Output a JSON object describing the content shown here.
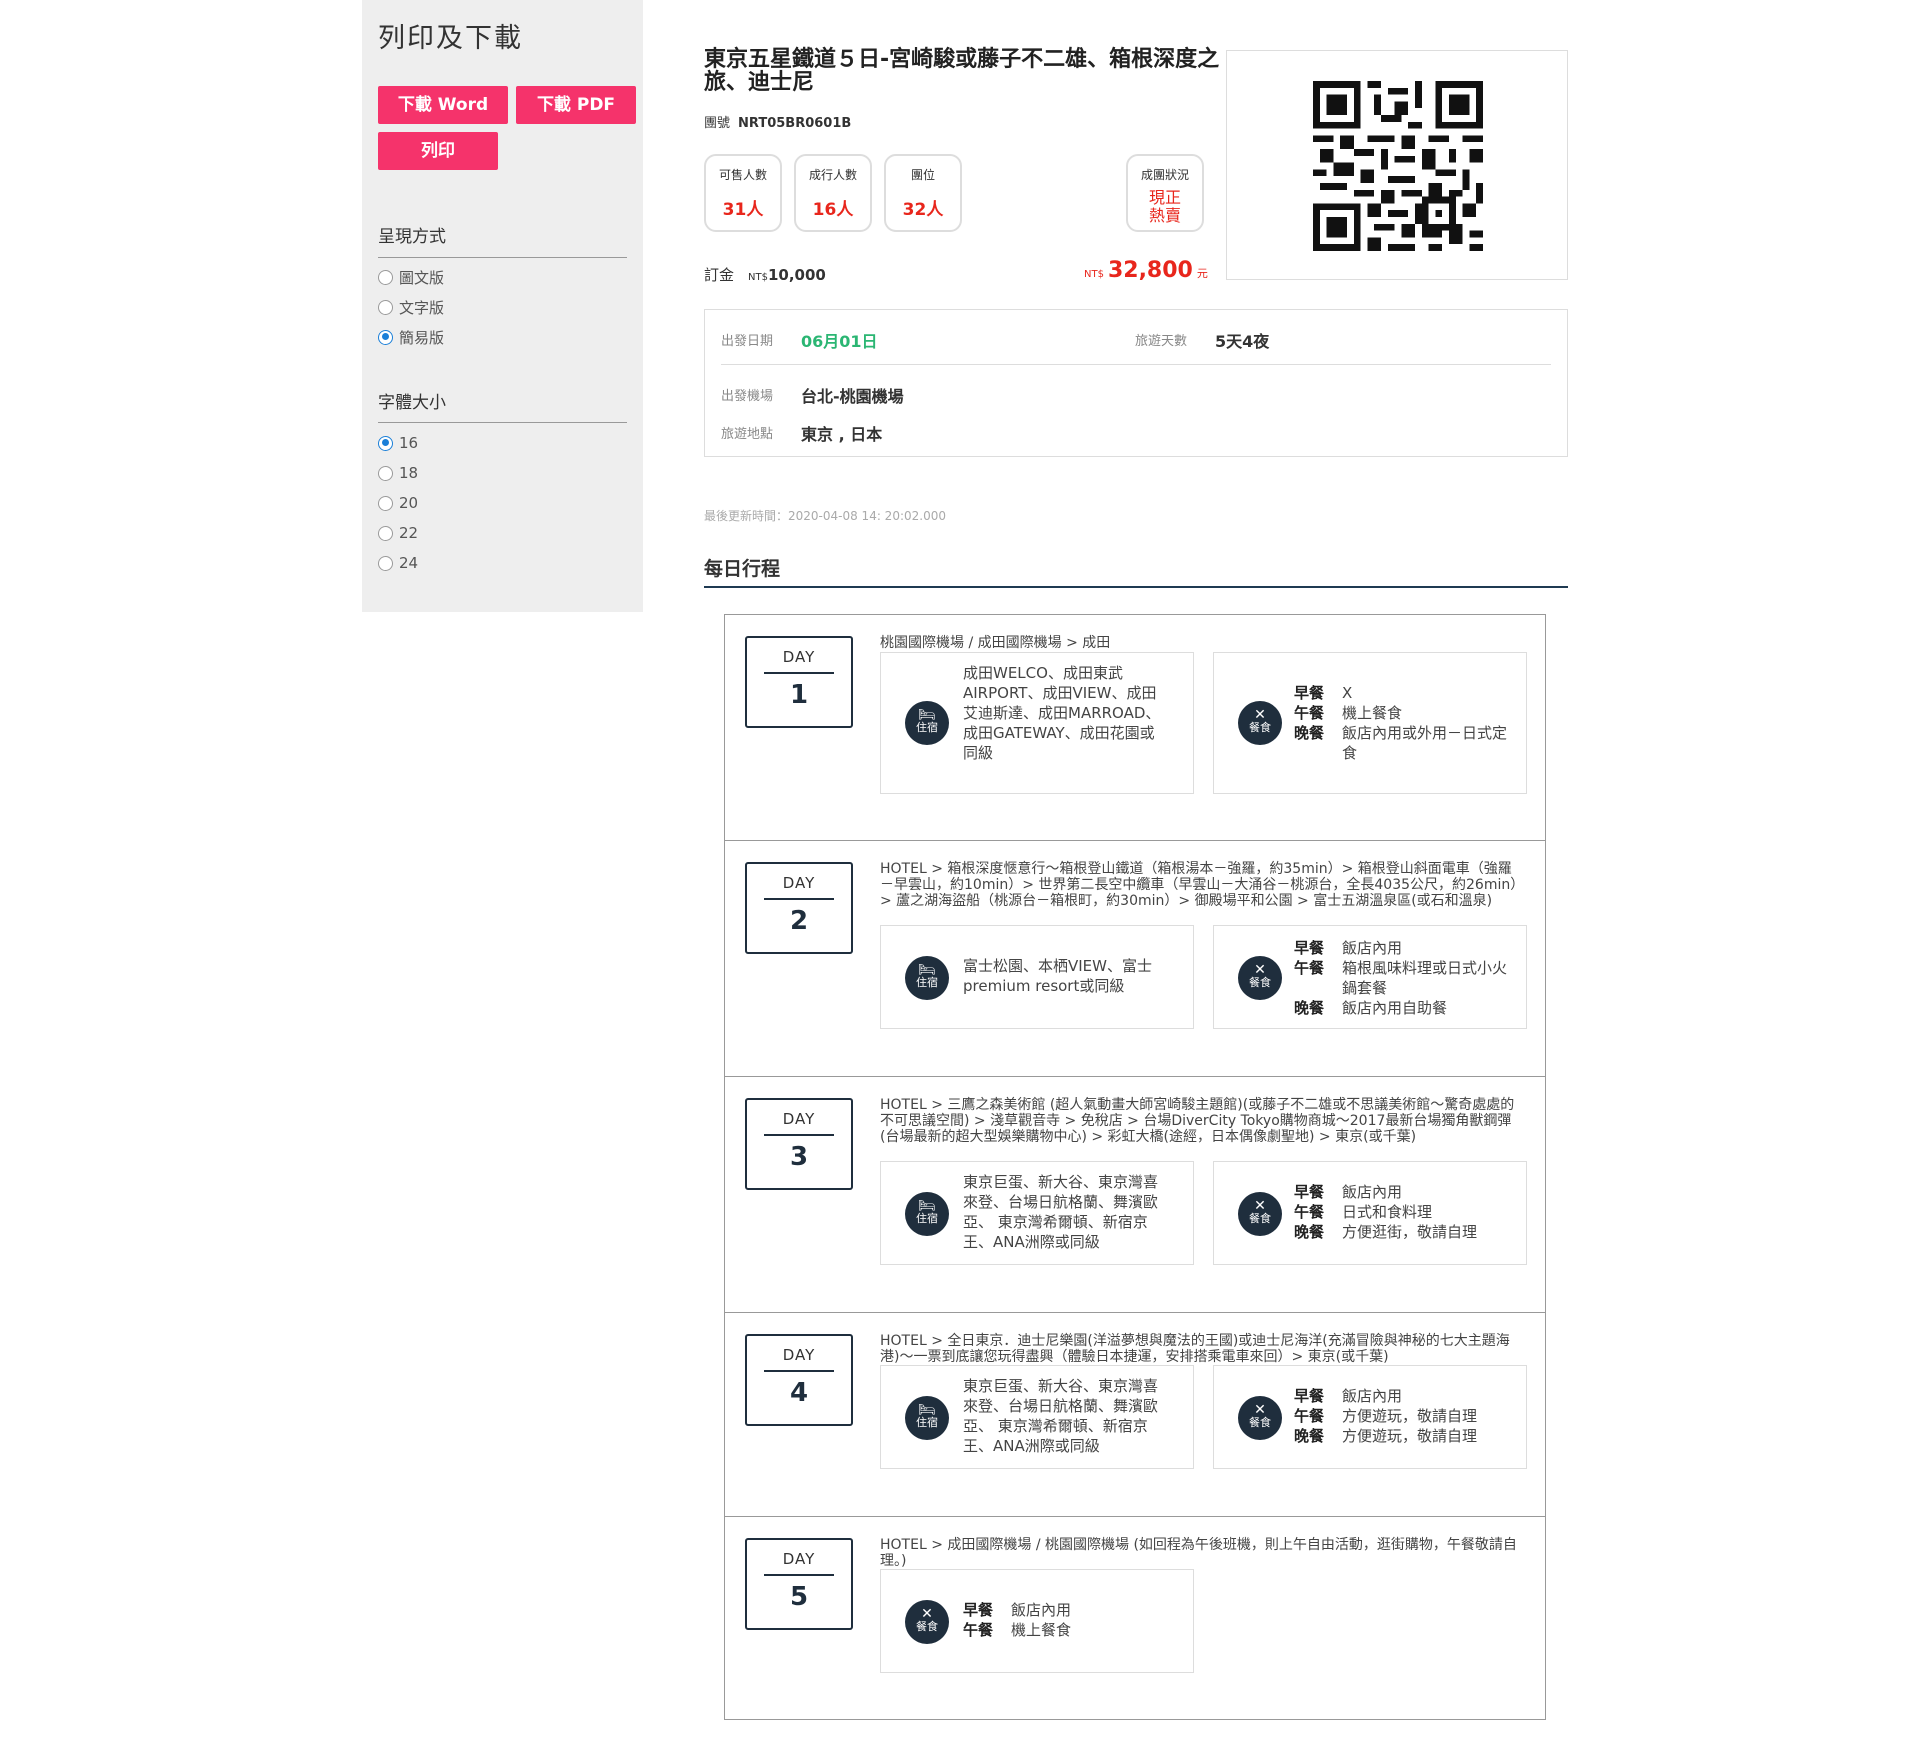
{
  "sidebar": {
    "title": "列印及下載",
    "btn_word": "下載 Word",
    "btn_pdf": "下載 PDF",
    "btn_print": "列印",
    "display_title": "呈現方式",
    "display_options": [
      "圖文版",
      "文字版",
      "簡易版"
    ],
    "display_selected": "簡易版",
    "font_title": "字體大小",
    "font_options": [
      "16",
      "18",
      "20",
      "22",
      "24"
    ],
    "font_selected": "16"
  },
  "tour": {
    "title": "東京五星鐵道５日-宮崎駿或藤子不二雄、箱根深度之旅、迪士尼",
    "code_label": "團號",
    "code": "NRT05BR0601B",
    "stats": [
      {
        "label": "可售人數",
        "value": "31人"
      },
      {
        "label": "成行人數",
        "value": "16人"
      },
      {
        "label": "團位",
        "value": "32人"
      }
    ],
    "status_label": "成團狀況",
    "status_line1": "現正",
    "status_line2": "熱賣",
    "deposit_label": "訂金",
    "deposit_currency": "NT$",
    "deposit_value": "10,000",
    "price_currency": "NT$",
    "price_value": "32,800",
    "price_unit": "元"
  },
  "info": {
    "depart_date_label": "出發日期",
    "depart_date": "06月01日",
    "days_label": "旅遊天數",
    "days": "5天4夜",
    "airport_label": "出發機場",
    "airport": "台北-桃園機場",
    "dest_label": "旅遊地點",
    "dest": "東京 , 日本"
  },
  "updated": "最後更新時間：2020-04-08 14: 20:02.000",
  "daily_title": "每日行程",
  "hotel_label": "住宿",
  "meal_label": "餐食",
  "meal_names": {
    "b": "早餐",
    "l": "午餐",
    "d": "晚餐"
  },
  "days": [
    {
      "day": "DAY",
      "num": "1",
      "route": "桃園國際機場 / 成田國際機場 > 成田",
      "hotel": "成田WELCO、成田東武AIRPORT、成田VIEW、成田艾迪斯達、成田MARROAD、成田GATEWAY、成田花園或同級",
      "breakfast": "X",
      "lunch": "機上餐食",
      "dinner": "飯店內用或外用－日式定食"
    },
    {
      "day": "DAY",
      "num": "2",
      "route": "HOTEL > 箱根深度愜意行～箱根登山鐵道（箱根湯本－強羅，約35min）> 箱根登山斜面電車（強羅－早雲山，約10min）> 世界第二長空中纜車（早雲山－大涌谷－桃源台，全長4035公尺，約26min）> 蘆之湖海盜船（桃源台－箱根町，約30min）> 御殿場平和公園 > 富士五湖溫泉區(或石和溫泉)",
      "hotel": "富士松園、本栖VIEW、富士premium resort或同級",
      "breakfast": "飯店內用",
      "lunch": "箱根風味料理或日式小火鍋套餐",
      "dinner": "飯店內用自助餐"
    },
    {
      "day": "DAY",
      "num": "3",
      "route": "HOTEL > 三鷹之森美術館 (超人氣動畫大師宮崎駿主題館)(或藤子不二雄或不思議美術館～驚奇處處的不可思議空間) > 淺草觀音寺 > 免稅店 > 台場DiverCity Tokyo購物商城～2017最新台場獨角獸鋼彈(台場最新的超大型娛樂購物中心) > 彩虹大橋(途經，日本偶像劇聖地) > 東京(或千葉)",
      "hotel": "東京巨蛋、新大谷、東京灣喜來登、台場日航格蘭、舞濱歐亞、 東京灣希爾頓、新宿京王、ANA洲際或同級",
      "breakfast": "飯店內用",
      "lunch": "日式和食料理",
      "dinner": "方便逛街，敬請自理"
    },
    {
      "day": "DAY",
      "num": "4",
      "route": "HOTEL > 全日東京．迪士尼樂園(洋溢夢想與魔法的王國)或迪士尼海洋(充滿冒險與神秘的七大主題海港)～一票到底讓您玩得盡興（體驗日本捷運，安排搭乘電車來回）> 東京(或千葉)",
      "hotel": "東京巨蛋、新大谷、東京灣喜來登、台場日航格蘭、舞濱歐亞、 東京灣希爾頓、新宿京王、ANA洲際或同級",
      "breakfast": "飯店內用",
      "lunch": "方便遊玩，敬請自理",
      "dinner": "方便遊玩，敬請自理"
    },
    {
      "day": "DAY",
      "num": "5",
      "route": "HOTEL > 成田國際機場 / 桃園國際機場 (如回程為午後班機，則上午自由活動，逛街購物，午餐敬請自理。)",
      "breakfast": "飯店內用",
      "lunch": "機上餐食"
    }
  ]
}
